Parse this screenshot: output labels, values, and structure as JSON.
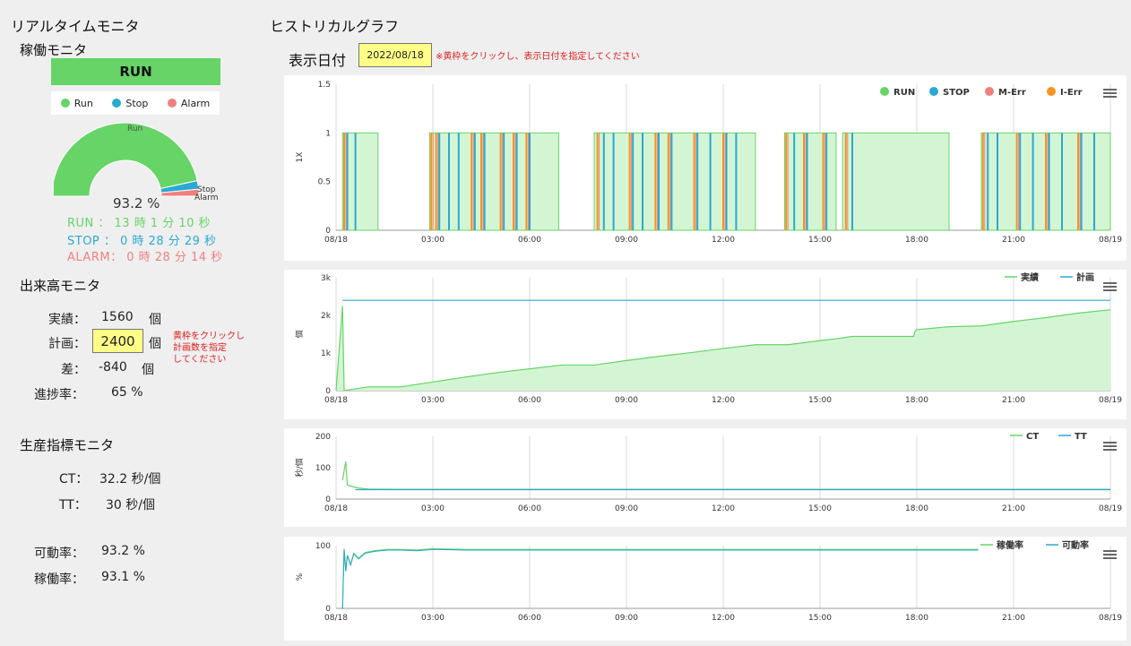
{
  "left": {
    "title": "リアルタイムモニタ",
    "operation": {
      "title": "稼働モニタ",
      "status": "RUN",
      "legend": [
        {
          "label": "Run",
          "color": "#66d466"
        },
        {
          "label": "Stop",
          "color": "#2aa9d2"
        },
        {
          "label": "Alarm",
          "color": "#f08080"
        }
      ],
      "gauge_labels": {
        "run": "Run",
        "stop": "Stop",
        "alarm": "Alarm"
      },
      "gauge_fraction": 0.932,
      "percent": "93.2 %",
      "run_line": "RUN ： 13 時 1 分 10 秒",
      "stop_line": "STOP ： 0 時 28 分 29 秒",
      "alarm_line": "ALARM： 0 時 28 分 14 秒"
    },
    "output": {
      "title": "出来高モニタ",
      "actual_label": "実績：",
      "actual_value": "1560",
      "plan_label": "計画：",
      "plan_value": "2400",
      "diff_label": "差：",
      "diff_value": "-840",
      "progress_label": "進捗率：",
      "progress_value": "65 %",
      "unit": "個",
      "hint_lines": [
        "黄枠をクリックし",
        "計画数を指定",
        "してください"
      ]
    },
    "index": {
      "title": "生産指標モニタ",
      "ct_label": "CT：",
      "ct_value": "32.2 秒/個",
      "tt_label": "TT：",
      "tt_value": "30 秒/個",
      "avail_label": "可動率：",
      "avail_value": "93.2 %",
      "oper_label": "稼働率：",
      "oper_value": "93.1 %"
    }
  },
  "right": {
    "title": "ヒストリカルグラフ",
    "date_label": "表示日付",
    "date_value": "2022/08/18",
    "date_hint": "※黄枠をクリックし、表示日付を指定してください"
  },
  "chart_data": [
    {
      "type": "area",
      "name": "status",
      "ylabel": "1X",
      "ylim": [
        0,
        1.5
      ],
      "y_ticks": [
        "0",
        "0.5",
        "1",
        "1.5"
      ],
      "x_ticks": [
        "08/18",
        "03:00",
        "06:00",
        "09:00",
        "12:00",
        "15:00",
        "18:00",
        "21:00",
        "08/19"
      ],
      "legend": [
        {
          "name": "RUN",
          "color": "#66d466"
        },
        {
          "name": "STOP",
          "color": "#2aa9d2"
        },
        {
          "name": "M-Err",
          "color": "#f08080"
        },
        {
          "name": "I-Err",
          "color": "#f7931e"
        }
      ],
      "run_intervals_hours": [
        [
          0.2,
          1.3
        ],
        [
          2.9,
          6.9
        ],
        [
          8.0,
          13.0
        ],
        [
          13.9,
          15.5
        ],
        [
          15.7,
          19.0
        ],
        [
          20.0,
          24.0
        ]
      ],
      "stop_marks_hours": [
        0.35,
        0.6,
        3.2,
        3.5,
        3.8,
        4.3,
        4.6,
        5.2,
        5.6,
        6.0,
        8.3,
        8.6,
        9.2,
        9.5,
        10.0,
        10.4,
        11.2,
        11.6,
        12.1,
        12.4,
        14.2,
        14.6,
        15.2,
        16.0,
        20.2,
        20.5,
        21.2,
        21.6,
        22.1,
        22.5,
        23.1,
        23.5
      ],
      "err_marks_hours": [
        0.25,
        2.95,
        3.1,
        4.2,
        4.5,
        5.1,
        5.5,
        5.9,
        8.1,
        9.1,
        9.9,
        10.3,
        11.1,
        12.0,
        13.95,
        14.5,
        15.1,
        15.8,
        20.05,
        21.1,
        22.0,
        23.0
      ]
    },
    {
      "type": "line",
      "name": "output",
      "ylabel": "個",
      "ylim": [
        0,
        3000
      ],
      "y_ticks": [
        "0",
        "1k",
        "2k",
        "3k"
      ],
      "x_ticks": [
        "08/18",
        "03:00",
        "06:00",
        "09:00",
        "12:00",
        "15:00",
        "18:00",
        "21:00",
        "08/19"
      ],
      "legend": [
        {
          "name": "実績",
          "color": "#66d466"
        },
        {
          "name": "計画",
          "color": "#2aa9d2"
        }
      ],
      "plan_value": 2400,
      "actual_points_hours": [
        [
          0.0,
          0
        ],
        [
          0.2,
          2250
        ],
        [
          0.25,
          0
        ],
        [
          1.0,
          100
        ],
        [
          2.0,
          100
        ],
        [
          3.0,
          230
        ],
        [
          4.0,
          360
        ],
        [
          5.0,
          480
        ],
        [
          6.0,
          580
        ],
        [
          7.0,
          680
        ],
        [
          8.0,
          680
        ],
        [
          9.0,
          800
        ],
        [
          10.0,
          910
        ],
        [
          11.0,
          1010
        ],
        [
          12.0,
          1120
        ],
        [
          13.0,
          1220
        ],
        [
          14.0,
          1220
        ],
        [
          15.0,
          1330
        ],
        [
          15.5,
          1380
        ],
        [
          16.0,
          1440
        ],
        [
          17.0,
          1440
        ],
        [
          17.9,
          1440
        ],
        [
          17.95,
          1590
        ],
        [
          18.0,
          1620
        ],
        [
          19.0,
          1700
        ],
        [
          20.0,
          1720
        ],
        [
          21.0,
          1840
        ],
        [
          22.0,
          1940
        ],
        [
          23.0,
          2060
        ],
        [
          24.0,
          2150
        ]
      ]
    },
    {
      "type": "line",
      "name": "cycle",
      "ylabel": "秒/個",
      "ylim": [
        0,
        200
      ],
      "y_ticks": [
        "0",
        "100",
        "200"
      ],
      "x_ticks": [
        "08/18",
        "03:00",
        "06:00",
        "09:00",
        "12:00",
        "15:00",
        "18:00",
        "21:00",
        "08/19"
      ],
      "legend": [
        {
          "name": "CT",
          "color": "#66d466"
        },
        {
          "name": "TT",
          "color": "#2aa9d2"
        }
      ],
      "tt_value": 30,
      "ct_points_hours": [
        [
          0.2,
          60
        ],
        [
          0.3,
          120
        ],
        [
          0.35,
          45
        ],
        [
          0.5,
          40
        ],
        [
          0.7,
          35
        ],
        [
          1.0,
          32
        ],
        [
          2.0,
          31
        ],
        [
          4.0,
          31
        ],
        [
          8.0,
          31
        ],
        [
          12.0,
          31
        ],
        [
          16.0,
          31
        ],
        [
          20.0,
          31
        ],
        [
          24.0,
          31
        ]
      ]
    },
    {
      "type": "line",
      "name": "rates",
      "ylabel": "%",
      "ylim": [
        0,
        100
      ],
      "y_ticks": [
        "0",
        "100"
      ],
      "x_ticks": [
        "08/18",
        "03:00",
        "06:00",
        "09:00",
        "12:00",
        "15:00",
        "18:00",
        "21:00",
        "08/19"
      ],
      "legend": [
        {
          "name": "稼働率",
          "color": "#66d466"
        },
        {
          "name": "可動率",
          "color": "#2aa9d2"
        }
      ],
      "rate_points_hours": [
        [
          0.2,
          0
        ],
        [
          0.25,
          95
        ],
        [
          0.3,
          60
        ],
        [
          0.35,
          85
        ],
        [
          0.45,
          70
        ],
        [
          0.55,
          88
        ],
        [
          0.7,
          80
        ],
        [
          0.9,
          89
        ],
        [
          1.2,
          92
        ],
        [
          1.6,
          94
        ],
        [
          2.0,
          94
        ],
        [
          2.5,
          93
        ],
        [
          3.0,
          95
        ],
        [
          4.0,
          94
        ],
        [
          6.0,
          94
        ],
        [
          9.0,
          94
        ],
        [
          12.0,
          94
        ],
        [
          15.0,
          94
        ],
        [
          18.0,
          94
        ],
        [
          19.9,
          94
        ]
      ]
    }
  ]
}
